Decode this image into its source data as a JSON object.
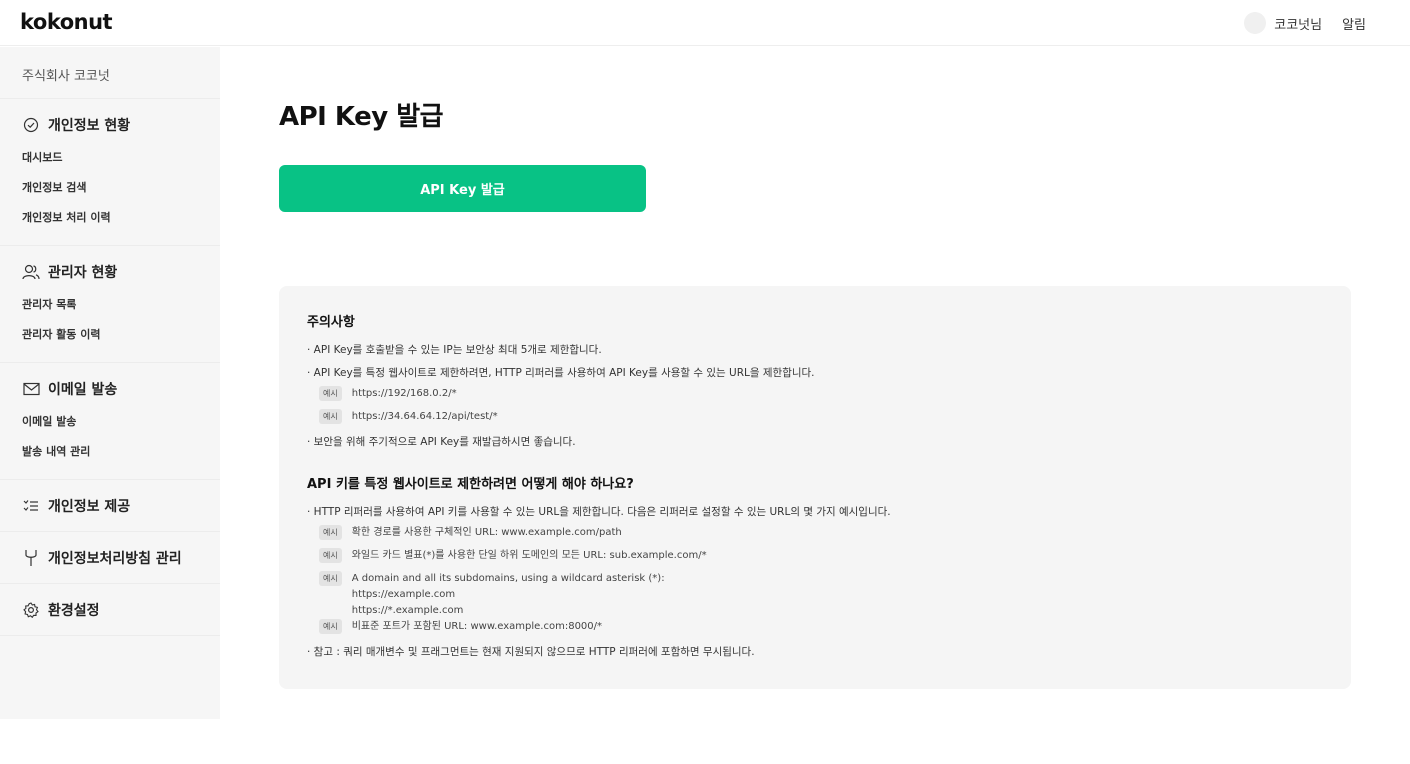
{
  "header": {
    "logo": "kokonut",
    "user_name": "코코넛님",
    "alarm_label": "알림"
  },
  "sidebar": {
    "company": "주식회사 코코넛",
    "sections": [
      {
        "title": "개인정보 현황",
        "icon": "check-circle-icon",
        "items": [
          "대시보드",
          "개인정보 검색",
          "개인정보 처리 이력"
        ]
      },
      {
        "title": "관리자 현황",
        "icon": "users-icon",
        "items": [
          "관리자 목록",
          "관리자 활동 이력"
        ]
      },
      {
        "title": "이메일 발송",
        "icon": "mail-icon",
        "items": [
          "이메일 발송",
          "발송 내역 관리"
        ]
      },
      {
        "title": "개인정보 제공",
        "icon": "list-icon",
        "items": []
      },
      {
        "title": "개인정보처리방침 관리",
        "icon": "tool-icon",
        "items": []
      },
      {
        "title": "환경설정",
        "icon": "gear-icon",
        "items": []
      }
    ]
  },
  "main": {
    "title": "API Key 발급",
    "issue_button": "API Key 발급",
    "notice": {
      "heading1": "주의사항",
      "lines1": [
        "· API Key를 호출받을 수 있는 IP는 보안상 최대 5개로 제한합니다.",
        "· API Key를 특정 웹사이트로 제한하려면, HTTP 리퍼러를 사용하여 API Key를 사용할 수 있는 URL을 제한합니다."
      ],
      "examples1": [
        "https://192/168.0.2/*",
        "https://34.64.64.12/api/test/*"
      ],
      "line_after1": "· 보안을 위해 주기적으로 API Key를 재발급하시면 좋습니다.",
      "heading2": "API 키를 특정 웹사이트로 제한하려면 어떻게 해야 하나요?",
      "line2": "· HTTP 리퍼러를 사용하여 API 키를 사용할 수 있는 URL을 제한합니다. 다음은 리퍼러로 설정할 수 있는 URL의 몇 가지 예시입니다.",
      "example_tag": "예시",
      "examples2": [
        "확한 경로를 사용한 구체적인 URL: www.example.com/path",
        "와일드 카드 별표(*)를 사용한 단일 하위 도메인의 모든 URL: sub.example.com/*"
      ],
      "example_multi": [
        "A domain and all its subdomains, using a wildcard asterisk (*):",
        "https://example.com",
        "https://*.example.com"
      ],
      "example_last": "비표준 포트가 포함된 URL: www.example.com:8000/*",
      "note": "· 참고 : 쿼리 매개변수 및 프래그먼트는 현재 지원되지 않으므로 HTTP 리퍼러에 포함하면 무시됩니다."
    }
  },
  "colors": {
    "accent": "#08c285",
    "sidebar_bg": "#f6f6f6",
    "notice_bg": "#f5f5f5"
  }
}
